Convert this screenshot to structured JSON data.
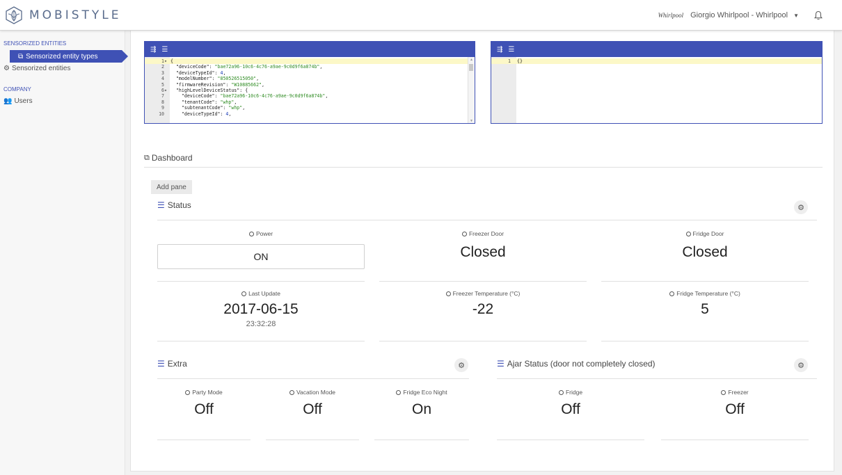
{
  "app": {
    "brand": "MOBISTYLE",
    "user_logo": "Whirlpool",
    "user_name": "Giorgio Whirlpool - Whirlpool"
  },
  "sidebar": {
    "sections": [
      {
        "label": "SENSORIZED ENTITIES",
        "items": [
          {
            "label": "Sensorized entity types",
            "icon": "copy-icon",
            "active": true
          },
          {
            "label": "Sensorized entities",
            "icon": "cogs-icon",
            "active": false
          }
        ]
      },
      {
        "label": "COMPANY",
        "items": [
          {
            "label": "Users",
            "icon": "users-icon",
            "active": false
          }
        ]
      }
    ]
  },
  "editors": {
    "left": {
      "lines": [
        {
          "n": "1",
          "fold": true,
          "text": "{"
        },
        {
          "n": "2",
          "text": "  \"deviceCode\": \"bae72a96-10c6-4c76-a9ae-9c0d9f6a874b\","
        },
        {
          "n": "3",
          "text": "  \"deviceTypeId\": 4,"
        },
        {
          "n": "4",
          "text": "  \"modelNumber\": \"850526515050\","
        },
        {
          "n": "5",
          "text": "  \"firmwareRevision\": \"W10885662\","
        },
        {
          "n": "6",
          "fold": true,
          "text": "  \"highLevelDeviceStatus\": {"
        },
        {
          "n": "7",
          "text": "    \"deviceCode\": \"bae72a96-10c6-4c76-a9ae-9c0d9f6a874b\","
        },
        {
          "n": "8",
          "text": "    \"tenantCode\": \"whp\","
        },
        {
          "n": "9",
          "text": "    \"subtenantCode\": \"whp\","
        },
        {
          "n": "10",
          "text": "    \"deviceTypeId\": 4,"
        }
      ]
    },
    "right": {
      "lines": [
        {
          "n": "1",
          "text": "{}"
        }
      ]
    }
  },
  "dashboard": {
    "title": "Dashboard",
    "add_pane_label": "Add pane",
    "panes": {
      "status": {
        "title": "Status",
        "widgets": {
          "power": {
            "label": "Power",
            "value": "ON"
          },
          "freezer_door": {
            "label": "Freezer Door",
            "value": "Closed"
          },
          "fridge_door": {
            "label": "Fridge Door",
            "value": "Closed"
          },
          "last_update": {
            "label": "Last Update",
            "value": "2017-06-15",
            "sub": "23:32:28"
          },
          "freezer_temp": {
            "label": "Freezer Temperature (°C)",
            "value": "-22"
          },
          "fridge_temp": {
            "label": "Fridge Temperature (°C)",
            "value": "5"
          }
        }
      },
      "extra": {
        "title": "Extra",
        "widgets": {
          "party_mode": {
            "label": "Party Mode",
            "value": "Off"
          },
          "vacation_mode": {
            "label": "Vacation Mode",
            "value": "Off"
          },
          "fridge_eco_night": {
            "label": "Fridge Eco Night",
            "value": "On"
          }
        }
      },
      "ajar": {
        "title": "Ajar Status (door not completely closed)",
        "widgets": {
          "fridge": {
            "label": "Fridge",
            "value": "Off"
          },
          "freezer": {
            "label": "Freezer",
            "value": "Off"
          }
        }
      }
    }
  },
  "colors": {
    "accent": "#3f51b5",
    "code_string": "#2e8b22",
    "code_number": "#1a3bb5",
    "active_line": "#fcf8c7"
  }
}
